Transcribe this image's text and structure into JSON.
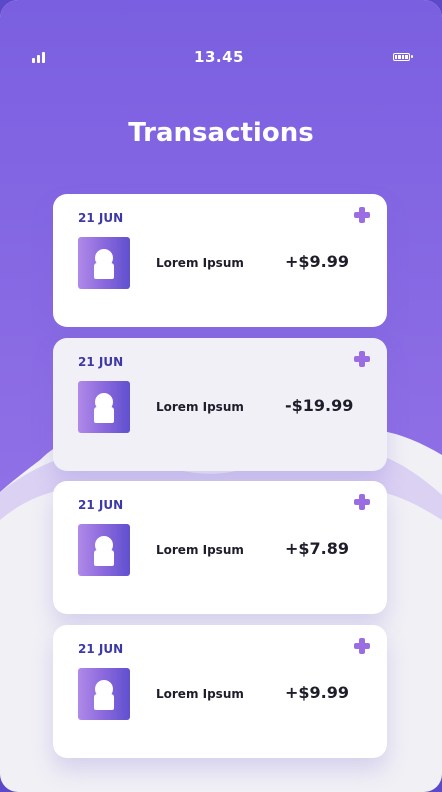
{
  "colors": {
    "gradient_top": "#7a5fe0",
    "gradient_bottom": "#8e6be3",
    "background_light": "#f1f0f5",
    "accent_plus": "#9b6de3",
    "date_text": "#3d3aa6"
  },
  "status_bar": {
    "time": "13.45",
    "signal_icon": "signal-bars-icon",
    "battery_icon": "battery-icon"
  },
  "header": {
    "title": "Transactions"
  },
  "transactions": [
    {
      "date": "21 JUN",
      "name": "Lorem Ipsum",
      "amount": "+$9.99",
      "action_icon": "plus-icon",
      "avatar_icon": "user-avatar-icon"
    },
    {
      "date": "21 JUN",
      "name": "Lorem Ipsum",
      "amount": "-$19.99",
      "action_icon": "plus-icon",
      "avatar_icon": "user-avatar-icon"
    },
    {
      "date": "21 JUN",
      "name": "Lorem Ipsum",
      "amount": "+$7.89",
      "action_icon": "plus-icon",
      "avatar_icon": "user-avatar-icon"
    },
    {
      "date": "21 JUN",
      "name": "Lorem Ipsum",
      "amount": "+$9.99",
      "action_icon": "plus-icon",
      "avatar_icon": "user-avatar-icon"
    }
  ]
}
